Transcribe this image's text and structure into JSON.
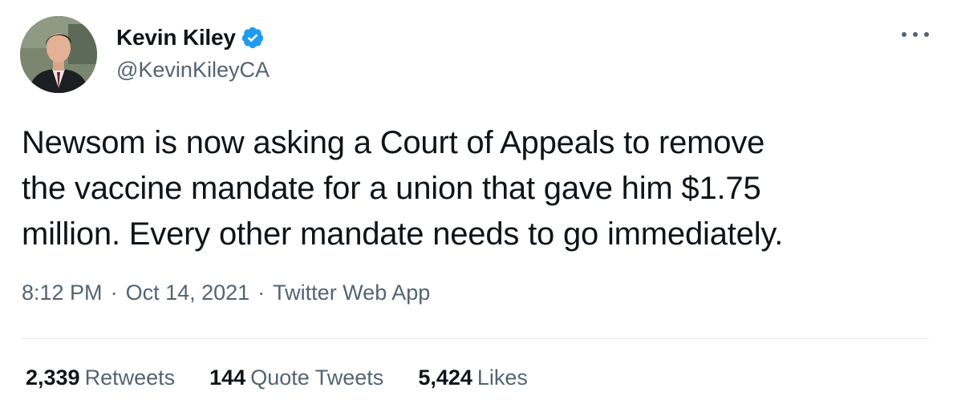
{
  "author": {
    "display_name": "Kevin Kiley",
    "handle": "@KevinKileyCA",
    "verified": true
  },
  "tweet": {
    "lines": [
      "Newsom is now asking a Court of Appeals to remove",
      "the vaccine mandate for a union that gave him $1.75",
      "million. Every other mandate needs to go immediately."
    ],
    "time": "8:12 PM",
    "date": "Oct 14, 2021",
    "source": "Twitter Web App",
    "separator": "·"
  },
  "stats": {
    "retweets_count": "2,339",
    "retweets_label": "Retweets",
    "quote_count": "144",
    "quote_label": "Quote Tweets",
    "likes_count": "5,424",
    "likes_label": "Likes"
  },
  "icons": {
    "verified": "verified-badge-icon",
    "more": "more-options-icon"
  },
  "colors": {
    "primary_text": "#0f1419",
    "secondary_text": "#536471",
    "verified_blue": "#1d9bf0",
    "divider": "#e6ecf0"
  }
}
